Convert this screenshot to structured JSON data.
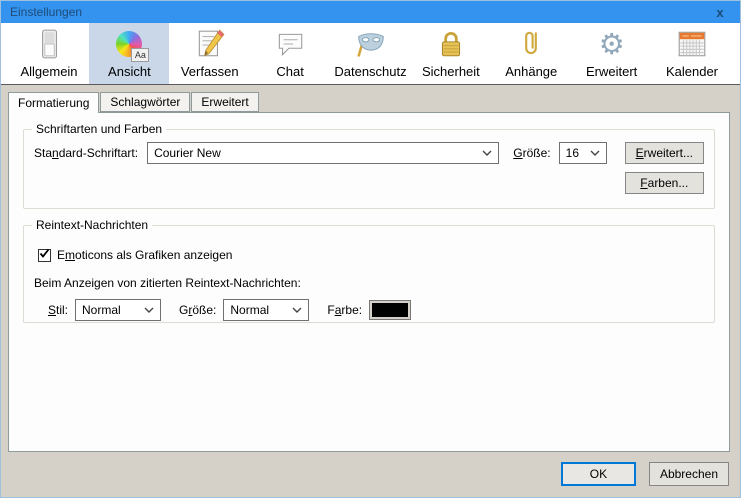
{
  "window": {
    "title": "Einstellungen",
    "close": "x"
  },
  "toolbar": {
    "items": [
      {
        "label": "Allgemein"
      },
      {
        "label": "Ansicht",
        "selected": true,
        "badge": "Aa"
      },
      {
        "label": "Verfassen"
      },
      {
        "label": "Chat"
      },
      {
        "label": "Datenschutz"
      },
      {
        "label": "Sicherheit"
      },
      {
        "label": "Anhänge"
      },
      {
        "label": "Erweitert"
      },
      {
        "label": "Kalender"
      }
    ]
  },
  "tabs": [
    {
      "label": "Formatierung",
      "active": true
    },
    {
      "label": "Schlagwörter",
      "active": false
    },
    {
      "label": "Erweitert",
      "active": false
    }
  ],
  "fonts_group": {
    "title": "Schriftarten und Farben",
    "font_label": {
      "pre": "Sta",
      "key": "n",
      "post": "dard-Schriftart:"
    },
    "font_value": "Courier New",
    "size_label": {
      "pre": "",
      "key": "G",
      "post": "röße:"
    },
    "size_value": "16",
    "advanced_button": {
      "pre": "",
      "key": "E",
      "post": "rweitert..."
    },
    "colors_button": {
      "pre": "",
      "key": "F",
      "post": "arben..."
    }
  },
  "plaintext_group": {
    "title": "Reintext-Nachrichten",
    "emoticons_label": {
      "pre": "E",
      "key": "m",
      "post": "oticons als Grafiken anzeigen"
    },
    "emoticons_checked": true,
    "quoted_text": "Beim Anzeigen von zitierten Reintext-Nachrichten:",
    "style_label": {
      "pre": "",
      "key": "S",
      "post": "til:"
    },
    "style_value": "Normal",
    "size_label": {
      "pre": "G",
      "key": "r",
      "post": "öße:"
    },
    "size_value": "Normal",
    "color_label": {
      "pre": "F",
      "key": "a",
      "post": "rbe:"
    },
    "color_value": "#000000",
    "color_style": "background:#000000"
  },
  "footer": {
    "ok": "OK",
    "cancel": "Abbrechen"
  },
  "colors": {
    "titlebar": "#3493ef",
    "titlebar_text": "#1d4c77",
    "toolbar_selected": "#c9d7e9",
    "dialog_bg": "#d5d1c9",
    "accent": "#0078d7",
    "swatch": "#000000"
  }
}
